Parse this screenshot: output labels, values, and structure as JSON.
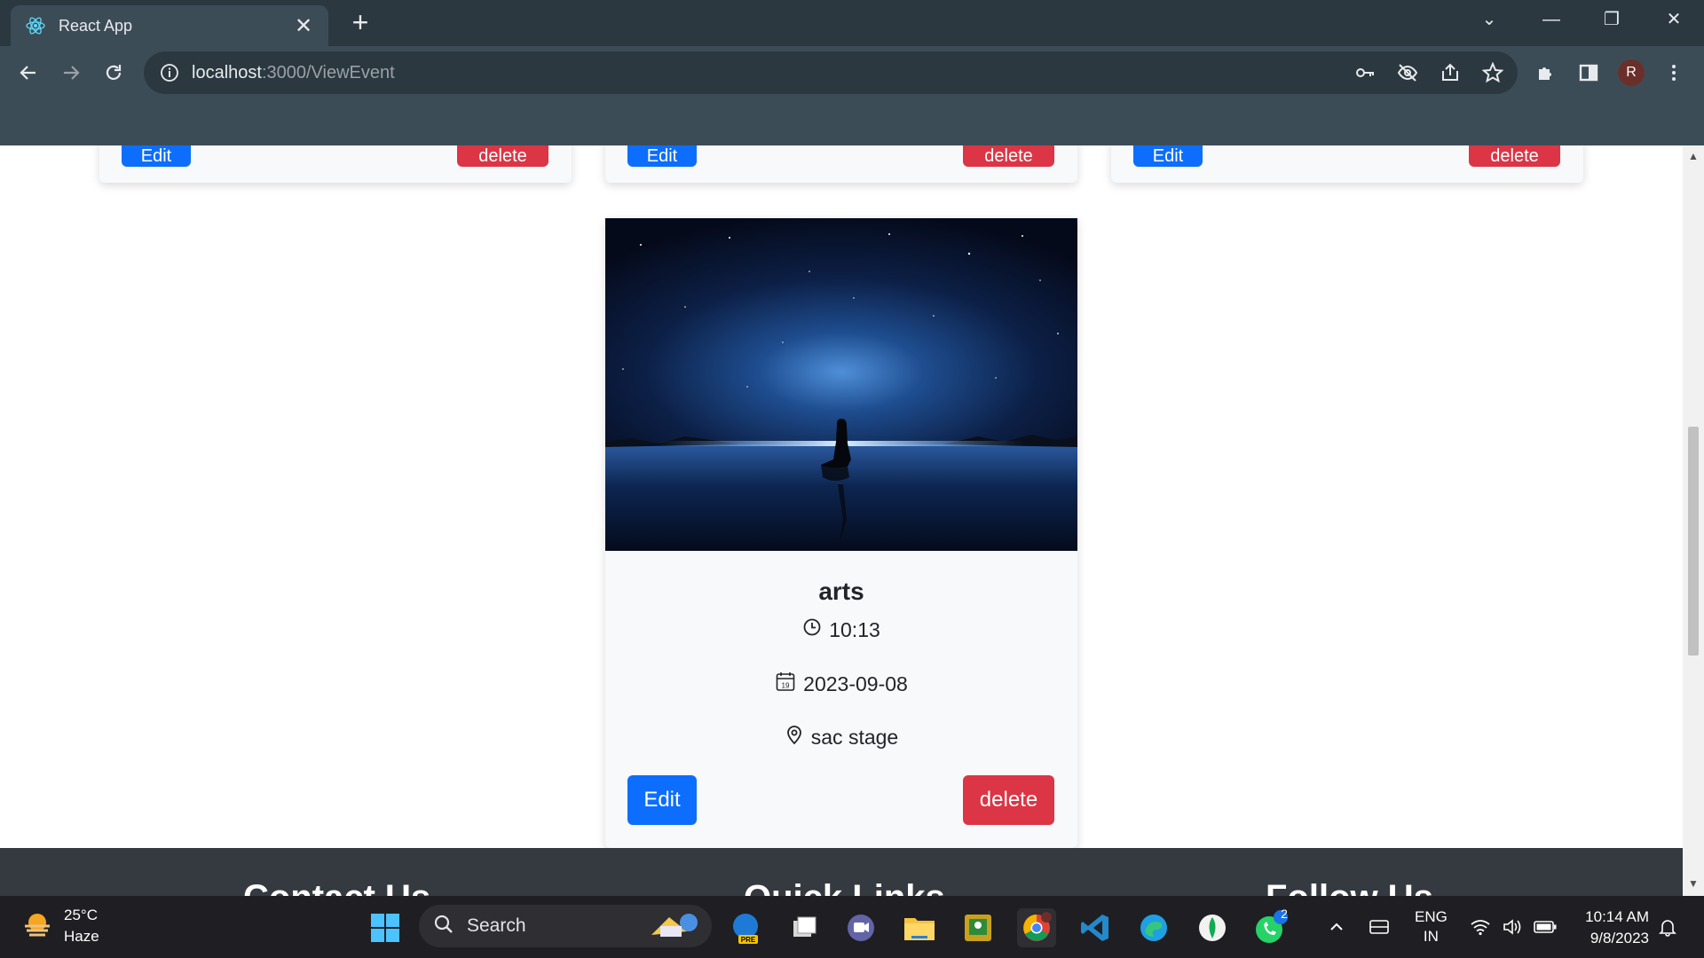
{
  "browser": {
    "tab_title": "React App",
    "close_tab_glyph": "✕",
    "new_tab_glyph": "+",
    "url_host": "localhost",
    "url_path": ":3000/ViewEvent",
    "profile_initial": "R",
    "window_controls": {
      "minimize": "—",
      "restore": "❐",
      "close": "✕",
      "tab_search": "⌄"
    }
  },
  "top_cards": [
    {
      "edit_label": "Edit",
      "delete_label": "delete"
    },
    {
      "edit_label": "Edit",
      "delete_label": "delete"
    },
    {
      "edit_label": "Edit",
      "delete_label": "delete"
    }
  ],
  "event_card": {
    "title": "arts",
    "time": "10:13",
    "date": "2023-09-08",
    "venue": "sac stage",
    "edit_label": "Edit",
    "delete_label": "delete",
    "image_description_icon": "night-sky-reflection-image"
  },
  "footer": {
    "headings": [
      "Contact Us",
      "Quick Links",
      "Follow Us"
    ]
  },
  "taskbar": {
    "weather_temp": "25°C",
    "weather_desc": "Haze",
    "search_label": "Search",
    "whatsapp_badge": "2",
    "language_line1": "ENG",
    "language_line2": "IN",
    "time": "10:14 AM",
    "date": "9/8/2023",
    "pre_badge": "PRE"
  },
  "colors": {
    "primary": "#0d6efd",
    "danger": "#dc3545",
    "chrome_bg": "#3c4c57",
    "footer_bg": "#343a40"
  }
}
